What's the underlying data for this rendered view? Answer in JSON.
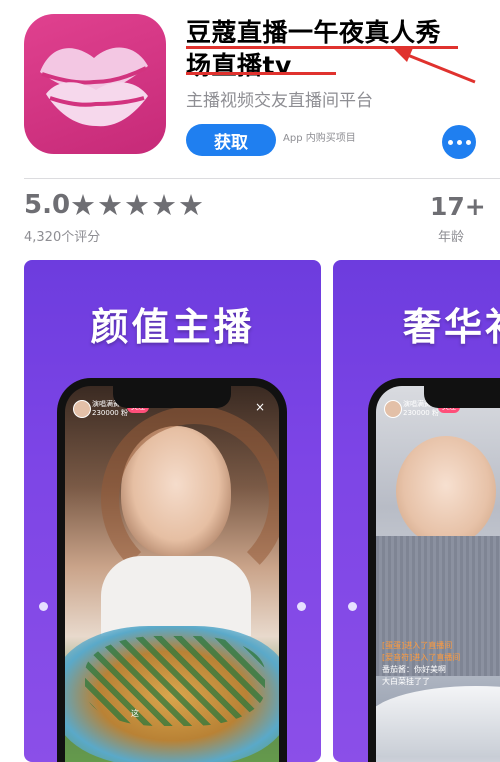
{
  "app": {
    "title_line1": "豆蔻直播一午夜真人秀",
    "title_line2": "场直播tv",
    "subtitle": "主播视频交友直播间平台",
    "get_label": "获取",
    "iap_label": "App 内购买项目"
  },
  "rating": {
    "value": "5.0",
    "stars": "★★★★★",
    "count": "4,320个评分",
    "age": "17+",
    "age_label": "年龄"
  },
  "screenshots": [
    {
      "heading": "颜值主播",
      "host_name": "演唱满簧...",
      "host_fans": "230000 粉",
      "follow": "关注",
      "chat_line": "这"
    },
    {
      "heading": "奢华补",
      "host_name": "演唱满簧...",
      "host_fans": "230000 粉",
      "follow": "关注",
      "chat": [
        "[蛋蛋]进入了直播间",
        "[爱音符]进入了直播间",
        "番茄酱：你好美啊",
        "大白菜挂了了"
      ]
    }
  ],
  "colors": {
    "accent": "#1f7ff0",
    "icon_bg": "#d2337f",
    "annotation": "#e0322e",
    "screenshot_bg": "#7440e0"
  }
}
